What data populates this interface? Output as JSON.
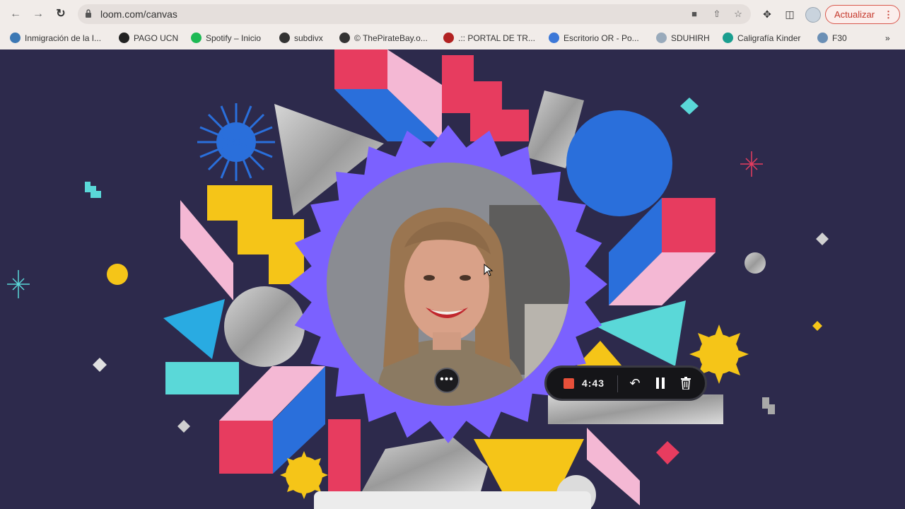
{
  "browser": {
    "url": "loom.com/canvas",
    "update_button": "Actualizar",
    "bookmarks": [
      {
        "label": "Inmigración de la I...",
        "icon": "wordpress-icon",
        "color": "#3c78b4"
      },
      {
        "label": "PAGO UCN",
        "icon": "globe-icon",
        "color": "#222222"
      },
      {
        "label": "Spotify – Inicio",
        "icon": "spotify-icon",
        "color": "#1db954"
      },
      {
        "label": "subdivx",
        "icon": "subdivx-icon",
        "color": "#333333"
      },
      {
        "label": "© ThePirateBay.o...",
        "icon": "pirate-ship-icon",
        "color": "#333333"
      },
      {
        "label": ".:: PORTAL DE TR...",
        "icon": "shield-icon",
        "color": "#b22222"
      },
      {
        "label": "Escritorio OR - Po...",
        "icon": "fin-icon",
        "color": "#3c78d8"
      },
      {
        "label": "SDUHIRH",
        "icon": "document-icon",
        "color": "#9ab"
      },
      {
        "label": "Caligrafía Kinder",
        "icon": "refresh-circle-icon",
        "color": "#1a9e8f"
      },
      {
        "label": "F30",
        "icon": "f30-icon",
        "color": "#6b8fb5"
      }
    ],
    "overflow": "»"
  },
  "recorder": {
    "time": "4:43",
    "more_label": "•••"
  }
}
